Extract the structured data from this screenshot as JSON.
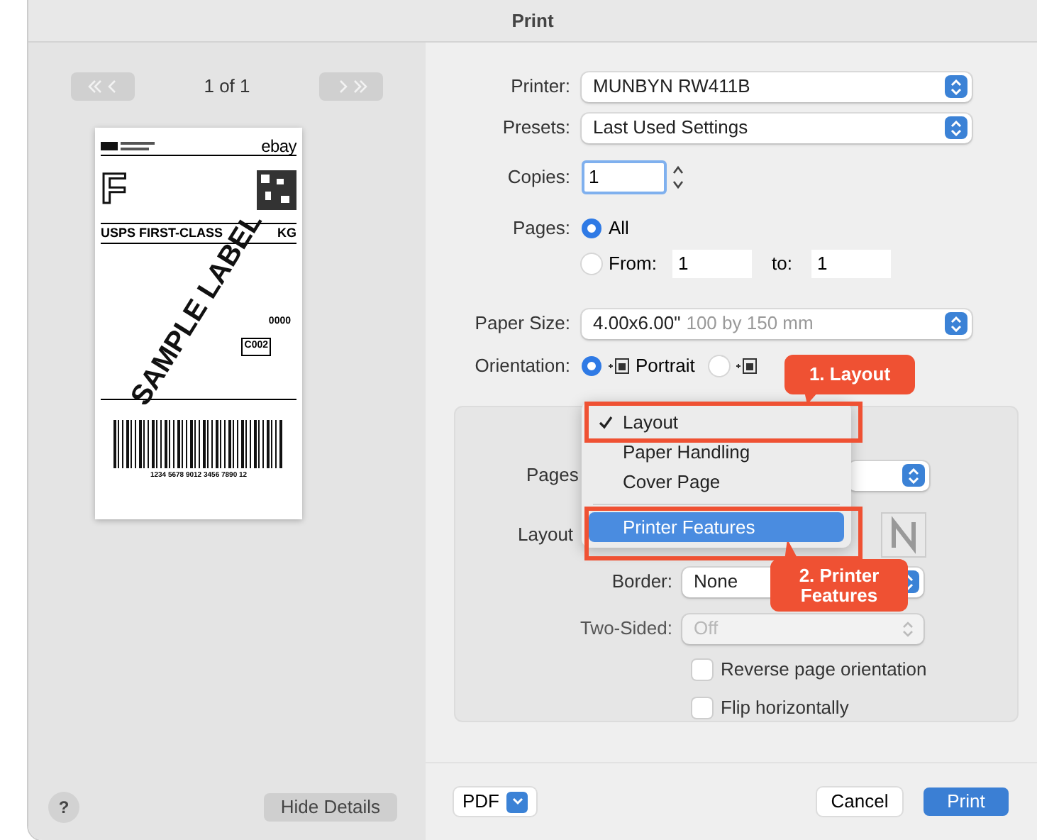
{
  "window": {
    "title": "Print"
  },
  "preview": {
    "page_indicator": "1 of 1",
    "label": {
      "logo": "ebay",
      "service_letter": "F",
      "service": "USPS FIRST-CLASS",
      "service_end": "KG",
      "code": "0000",
      "route": "C002",
      "tracking_number": "1234 5678 9012 3456 7890 12",
      "stamp": "SAMPLE LABEL"
    }
  },
  "form": {
    "printer": {
      "label": "Printer:",
      "value": "MUNBYN RW411B"
    },
    "presets": {
      "label": "Presets:",
      "value": "Last Used Settings"
    },
    "copies": {
      "label": "Copies:",
      "value": "1"
    },
    "pages": {
      "label": "Pages:",
      "options": [
        {
          "label": "All",
          "selected": true
        },
        {
          "label": "From:",
          "selected": false
        }
      ],
      "from_value": "1",
      "to_label": "to:",
      "to_value": "1"
    },
    "paper_size": {
      "label": "Paper Size:",
      "value": "4.00x6.00\"",
      "detail": "100 by 150 mm"
    },
    "orientation": {
      "label": "Orientation:",
      "options": [
        {
          "label": "Portrait",
          "selected": true
        },
        {
          "selected": false
        }
      ]
    }
  },
  "panel": {
    "pages_per_sheet_label": "Pages",
    "layout_label": "Layout",
    "border": {
      "label": "Border:",
      "value": "None"
    },
    "two_sided": {
      "label": "Two-Sided:",
      "value": "Off",
      "disabled": true
    },
    "checkboxes": [
      {
        "label": "Reverse page orientation",
        "checked": false
      },
      {
        "label": "Flip horizontally",
        "checked": false
      }
    ]
  },
  "section_menu": {
    "items": [
      {
        "label": "Layout",
        "checked": true,
        "selected": false
      },
      {
        "label": "Paper Handling",
        "checked": false,
        "selected": false
      },
      {
        "label": "Cover Page",
        "checked": false,
        "selected": false
      },
      {
        "label": "Printer Features",
        "checked": false,
        "selected": true
      }
    ]
  },
  "callouts": [
    {
      "text": "1. Layout"
    },
    {
      "text": "2. Printer Features"
    }
  ],
  "footer": {
    "help": "?",
    "hide_details": "Hide Details",
    "pdf": "PDF",
    "cancel": "Cancel",
    "print": "Print"
  }
}
